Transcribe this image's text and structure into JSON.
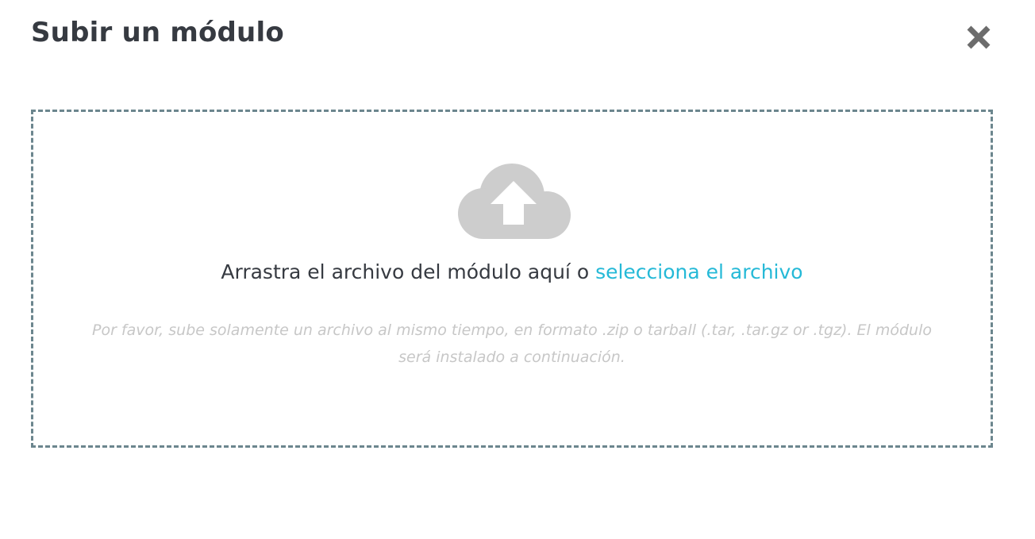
{
  "modal": {
    "title": "Subir un módulo"
  },
  "dropzone": {
    "prompt": "Arrastra el archivo del módulo aquí o ",
    "link_label": "selecciona el archivo",
    "help": "Por favor, sube solamente un archivo al mismo tiempo, en formato .zip o tarball (.tar, .tar.gz or .tgz). El módulo será instalado a continuación."
  },
  "icons": {
    "close": "close-icon",
    "upload": "cloud-upload-icon"
  },
  "colors": {
    "title": "#363a41",
    "link": "#25b9d7",
    "dashed_border": "#6c868e",
    "icon": "#cdcdcd",
    "close_icon": "#6c6c6c",
    "help_text": "#c7c7c7"
  }
}
